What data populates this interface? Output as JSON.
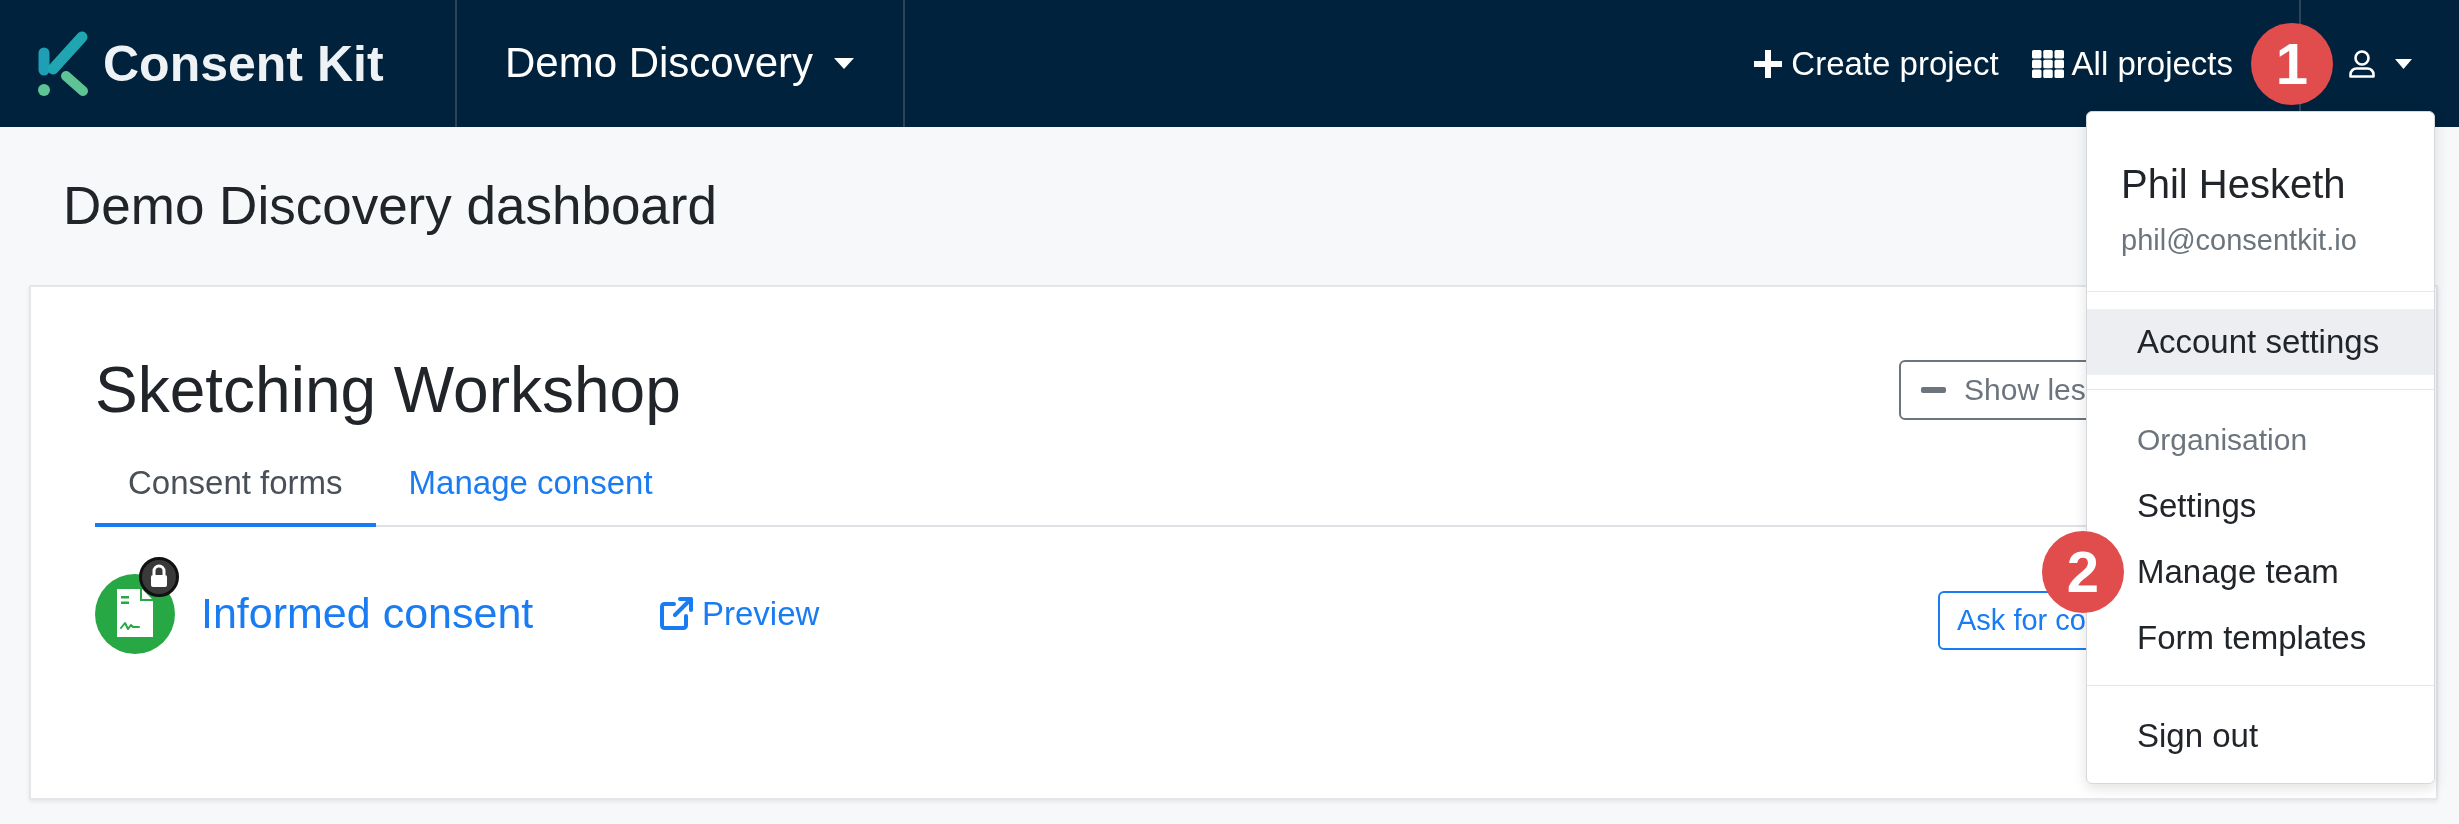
{
  "navbar": {
    "brand": "Consent Kit",
    "project_switcher": "Demo Discovery",
    "links": [
      {
        "kind": "create",
        "label": "Create project"
      },
      {
        "kind": "all",
        "label": "All projects"
      }
    ],
    "user_menu": {
      "expanded": true,
      "annotation": "1",
      "name": "Phil Hesketh",
      "email": "phil@consentkit.io",
      "groups": [
        {
          "items": [
            {
              "label": "Account settings",
              "selected": true
            }
          ]
        },
        {
          "header": "Organisation",
          "items": [
            {
              "label": "Settings",
              "selected": false
            },
            {
              "label": "Manage team",
              "selected": false,
              "annotation": "2"
            },
            {
              "label": "Form templates",
              "selected": false
            }
          ]
        },
        {
          "items": [
            {
              "label": "Sign out",
              "selected": false
            }
          ]
        }
      ]
    }
  },
  "page": {
    "title": "Demo Discovery dashboard"
  },
  "project_card": {
    "title": "Sketching Workshop",
    "toggle_button": "Show les",
    "tabs": [
      {
        "label": "Consent forms",
        "selected": true
      },
      {
        "label": "Manage consent",
        "selected": false
      }
    ],
    "forms": [
      {
        "name": "Informed consent",
        "locked": true,
        "preview": "Preview",
        "action": "Ask for co"
      }
    ]
  }
}
